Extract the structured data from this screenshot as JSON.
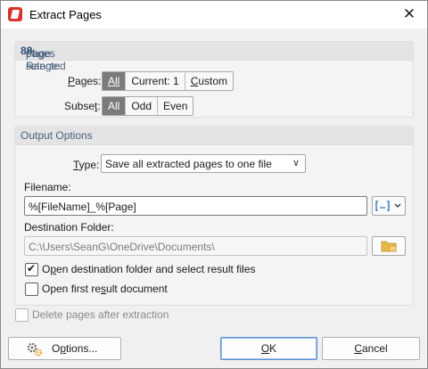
{
  "window": {
    "title": "Extract Pages",
    "close_glyph": "✕"
  },
  "page_range": {
    "prefix": "Page Range: ",
    "selected": "8",
    "of_text": " of ",
    "total": "8",
    "suffix": " pages selected",
    "pages_label_u": "P",
    "pages_label_rest": "ages:",
    "pages_options": [
      {
        "label": "All",
        "u": true,
        "active": true
      },
      {
        "label": "Current: 1",
        "u": false,
        "active": false
      },
      {
        "label_u": "C",
        "label_rest": "ustom",
        "active": false
      }
    ],
    "subset_label_pre": "Subse",
    "subset_label_u": "t",
    "subset_label_rest": ":",
    "subset_options": [
      {
        "label": "All",
        "active": true
      },
      {
        "label": "Odd",
        "active": false
      },
      {
        "label": "Even",
        "active": false
      }
    ]
  },
  "output": {
    "heading": "Output Options",
    "type_label_u": "T",
    "type_label_rest": "ype:",
    "type_value": "Save all extracted pages to one file",
    "filename_label": "Filename:",
    "filename_value": "%[FileName]_%[Page]",
    "destination_label": "Destination Folder:",
    "destination_value": "C:\\Users\\SeanG\\OneDrive\\Documents\\",
    "open_folder_pre": "O",
    "open_folder_u": "p",
    "open_folder_rest": "en destination folder and select result files",
    "open_folder_checked": true,
    "open_first_pre": "Open first re",
    "open_first_u": "s",
    "open_first_rest": "ult document",
    "open_first_checked": false
  },
  "delete_pages": {
    "label": "Delete pages after extraction",
    "checked": false,
    "enabled": false
  },
  "buttons": {
    "options_pre": "O",
    "options_u": "p",
    "options_rest": "tions...",
    "ok_u": "O",
    "ok_rest": "K",
    "cancel_u": "C",
    "cancel_rest": "ancel"
  },
  "icons": {
    "app": "pdf-app-icon",
    "close": "close-icon",
    "chevron": "chevron-down-icon",
    "macro": "macro-insert-icon",
    "folder": "folder-browse-icon",
    "options": "gears-icon"
  },
  "colors": {
    "accent": "#5a8ed6",
    "segment_active": "#7b7b7b",
    "panel_heading": "#4a6080"
  }
}
